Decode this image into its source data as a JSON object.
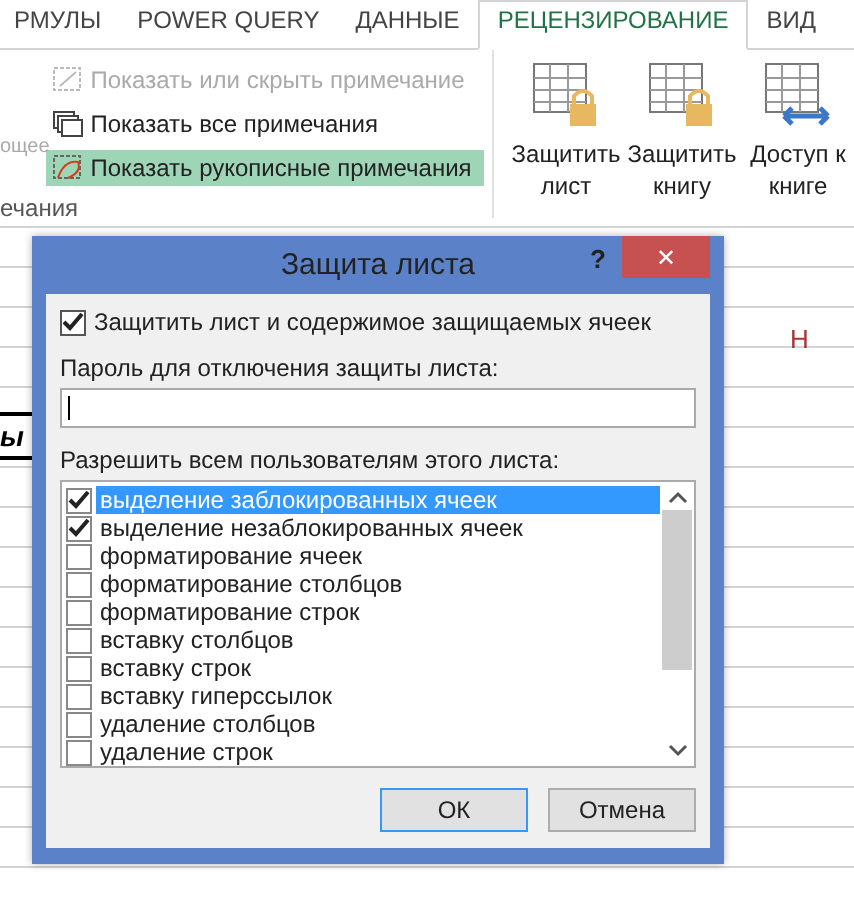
{
  "ribbon_tabs": [
    {
      "label": "РМУЛЫ",
      "selected": false
    },
    {
      "label": "POWER QUERY",
      "selected": false
    },
    {
      "label": "ДАННЫЕ",
      "selected": false
    },
    {
      "label": "РЕЦЕНЗИРОВАНИЕ",
      "selected": true
    },
    {
      "label": "ВИД",
      "selected": false
    }
  ],
  "ribbon": {
    "cut_command": "ощее",
    "group_label": "ечания",
    "commands": [
      {
        "label": "Показать или скрыть примечание",
        "kind": "note",
        "disabled": true,
        "selected": false
      },
      {
        "label": "Показать все примечания",
        "kind": "notes",
        "disabled": false,
        "selected": false
      },
      {
        "label": "Показать рукописные примечания",
        "kind": "ink",
        "disabled": false,
        "selected": true
      }
    ],
    "big_buttons": [
      {
        "label": "Защитить лист",
        "kind": "lock"
      },
      {
        "label": "Защитить книгу",
        "kind": "lock"
      },
      {
        "label": "Доступ к книге",
        "kind": "share"
      }
    ]
  },
  "sheet": {
    "column_header": "H",
    "cell_text": "ы"
  },
  "dialog": {
    "title": "Защита листа",
    "help": "?",
    "close": "✕",
    "protect": {
      "label": "Защитить лист и содержимое защищаемых ячеек",
      "checked": true
    },
    "password_label": "Пароль для отключения защиты листа:",
    "permissions_label": "Разрешить всем пользователям этого листа:",
    "permissions": [
      {
        "label": "выделение заблокированных ячеек",
        "checked": true,
        "selected": true
      },
      {
        "label": "выделение незаблокированных ячеек",
        "checked": true,
        "selected": false
      },
      {
        "label": "форматирование ячеек",
        "checked": false,
        "selected": false
      },
      {
        "label": "форматирование столбцов",
        "checked": false,
        "selected": false
      },
      {
        "label": "форматирование строк",
        "checked": false,
        "selected": false
      },
      {
        "label": "вставку столбцов",
        "checked": false,
        "selected": false
      },
      {
        "label": "вставку строк",
        "checked": false,
        "selected": false
      },
      {
        "label": "вставку гиперссылок",
        "checked": false,
        "selected": false
      },
      {
        "label": "удаление столбцов",
        "checked": false,
        "selected": false
      },
      {
        "label": "удаление строк",
        "checked": false,
        "selected": false
      }
    ],
    "buttons": [
      "ОК",
      "Отмена"
    ]
  }
}
